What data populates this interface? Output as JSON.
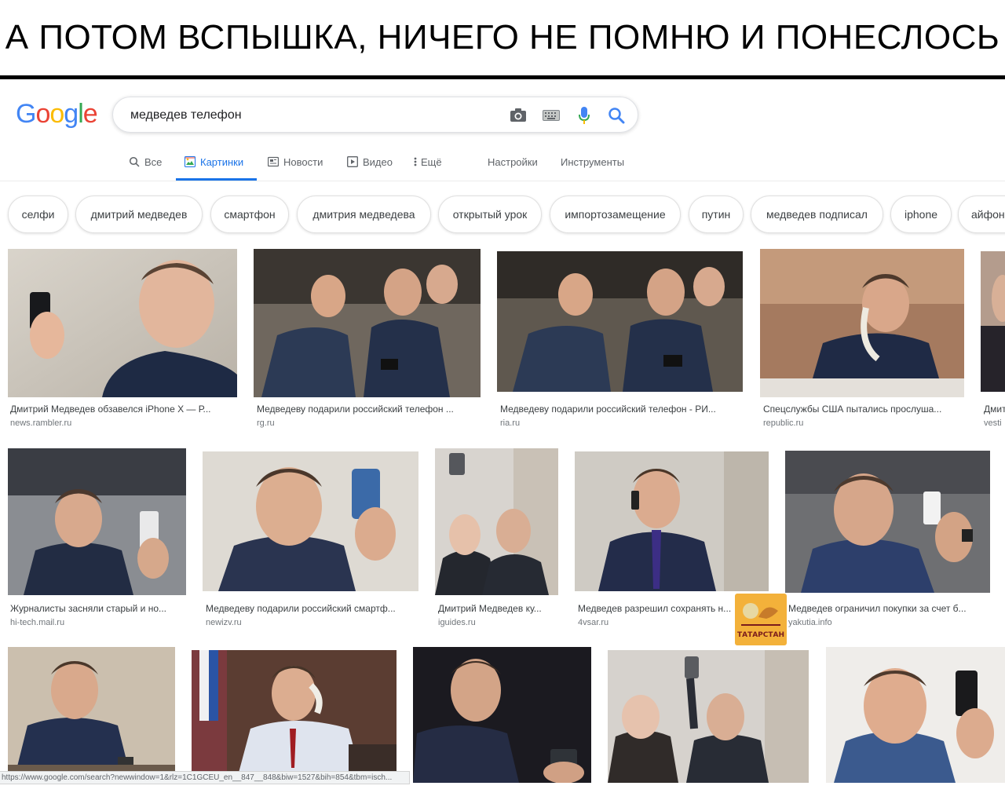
{
  "caption": "А ПОТОМ ВСПЫШКА, НИЧЕГО НЕ ПОМНЮ И ПОНЕСЛОСЬ",
  "colors": {
    "accent": "#1a73e8",
    "logo_blue": "#4285f4",
    "logo_red": "#ea4335",
    "logo_yellow": "#fbbc05",
    "logo_green": "#34a853"
  },
  "logo": {
    "letters": [
      "G",
      "o",
      "o",
      "g",
      "l",
      "e"
    ]
  },
  "search": {
    "query": "медведев телефон",
    "icons": [
      "camera-icon",
      "keyboard-icon",
      "microphone-icon",
      "search-icon"
    ]
  },
  "tabs": [
    {
      "label": "Все",
      "icon": "search-icon",
      "active": false
    },
    {
      "label": "Картинки",
      "icon": "image-icon",
      "active": true
    },
    {
      "label": "Новости",
      "icon": "news-icon",
      "active": false
    },
    {
      "label": "Видео",
      "icon": "play-icon",
      "active": false
    },
    {
      "label": "Ещё",
      "icon": "more-vert-icon",
      "active": false
    },
    {
      "label": "Настройки",
      "active": false
    },
    {
      "label": "Инструменты",
      "active": false
    }
  ],
  "chips": [
    "селфи",
    "дмитрий медведев",
    "смартфон",
    "дмитрия медведева",
    "открытый урок",
    "импортозамещение",
    "путин",
    "медведев подписал",
    "iphone",
    "айфон"
  ],
  "results": [
    {
      "title": "Дмитрий Медведев обзавелся iPhone X — Р...",
      "source": "news.rambler.ru"
    },
    {
      "title": "Медведеву подарили российский телефон ...",
      "source": "rg.ru"
    },
    {
      "title": "Медведеву подарили российский телефон - РИ...",
      "source": "ria.ru"
    },
    {
      "title": "Спецслужбы США пытались прослуша...",
      "source": "republic.ru"
    },
    {
      "title": "Дмит",
      "source": "vesti"
    },
    {
      "title": "Журналисты засняли старый и но...",
      "source": "hi-tech.mail.ru"
    },
    {
      "title": "Медведеву подарили российский смартф...",
      "source": "newizv.ru"
    },
    {
      "title": "Дмитрий Медведев ку...",
      "source": "iguides.ru"
    },
    {
      "title": "Медведев разрешил сохранять н...",
      "source": "4vsar.ru"
    },
    {
      "title": "Медведев ограничил покупки за счет б...",
      "source": "yakutia.info"
    }
  ],
  "status_url": "https://www.google.com/search?newwindow=1&rlz=1C1GCEU_en__847__848&biw=1527&bih=854&tbm=isch...",
  "watermark": {
    "text": "ТАТАРСТАН"
  }
}
